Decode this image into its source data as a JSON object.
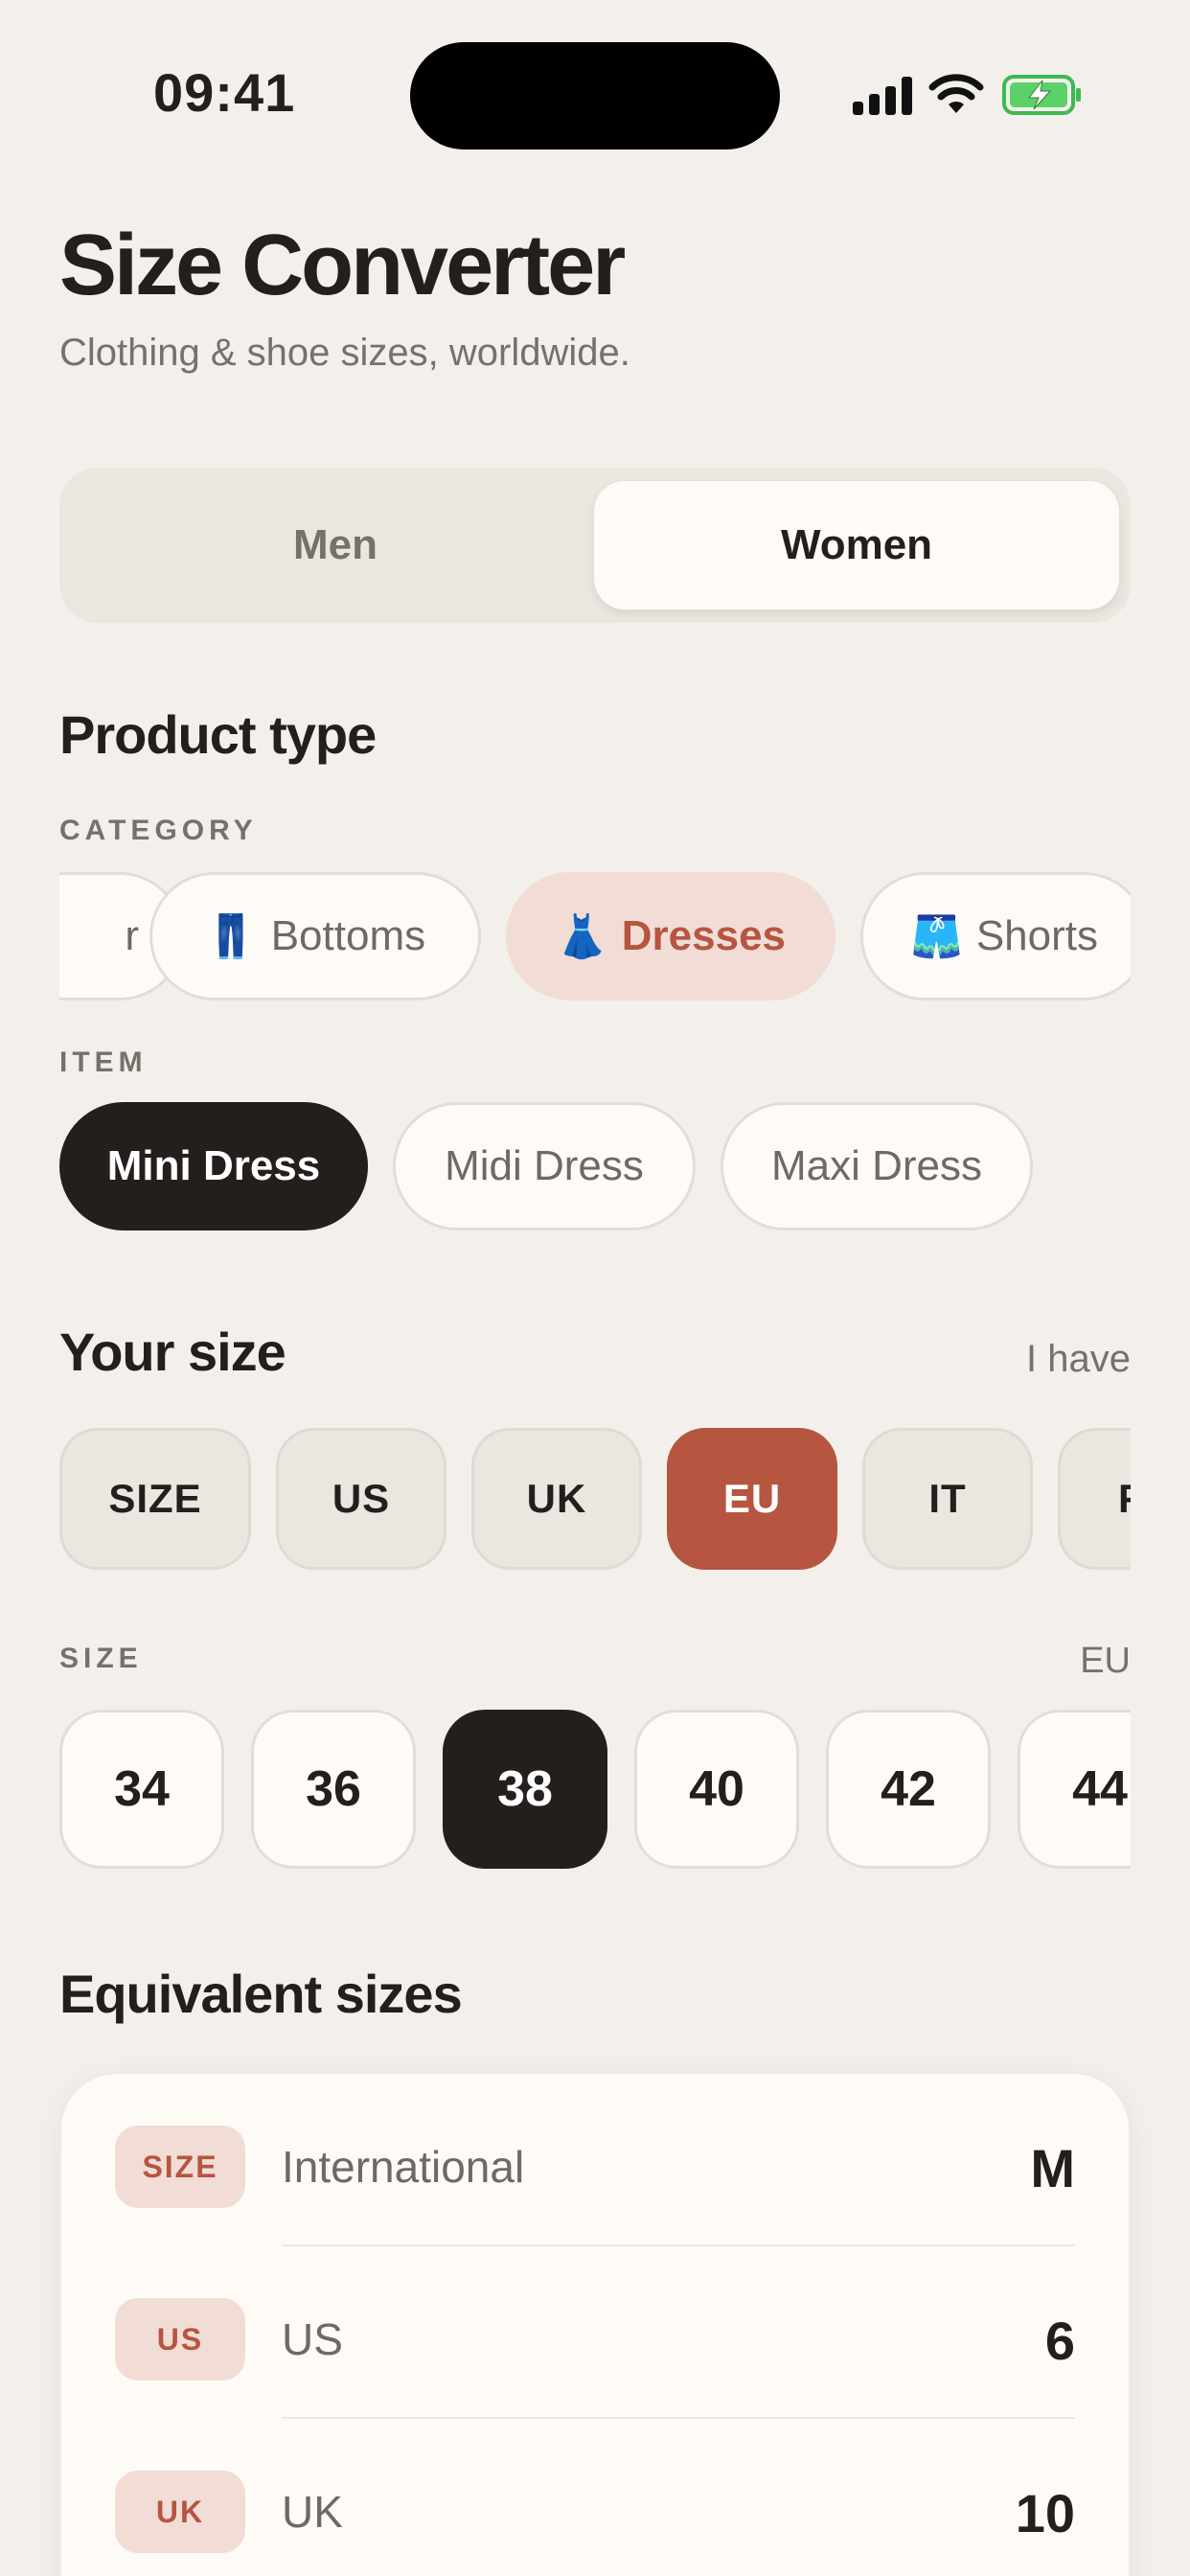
{
  "status": {
    "time": "09:41"
  },
  "header": {
    "title": "Size Converter",
    "subtitle": "Clothing & shoe sizes, worldwide."
  },
  "gender_toggle": {
    "options": [
      "Men",
      "Women"
    ],
    "selected": "Women"
  },
  "product": {
    "section_title": "Product type",
    "category_label": "CATEGORY",
    "categories": [
      {
        "icon": "",
        "label": "r"
      },
      {
        "icon": "👖",
        "label": "Bottoms"
      },
      {
        "icon": "👗",
        "label": "Dresses"
      },
      {
        "icon": "🩳",
        "label": "Shorts"
      }
    ],
    "selected_category": "Dresses",
    "item_label": "ITEM",
    "items": [
      "Mini Dress",
      "Midi Dress",
      "Maxi Dress"
    ],
    "selected_item": "Mini Dress"
  },
  "your_size": {
    "section_title": "Your size",
    "hint": "I have",
    "systems": [
      "SIZE",
      "US",
      "UK",
      "EU",
      "IT",
      "F"
    ],
    "selected_system": "EU",
    "size_label": "SIZE",
    "size_system": "EU",
    "sizes": [
      "34",
      "36",
      "38",
      "40",
      "42",
      "44"
    ],
    "selected_size": "38"
  },
  "equivalent": {
    "section_title": "Equivalent sizes",
    "rows": [
      {
        "badge": "SIZE",
        "label": "International",
        "value": "M"
      },
      {
        "badge": "US",
        "label": "US",
        "value": "6"
      },
      {
        "badge": "UK",
        "label": "UK",
        "value": "10"
      }
    ]
  },
  "colors": {
    "accent": "#B65540",
    "dark": "#241F1C",
    "background": "#F3F0EB",
    "chip_selected_bg": "#F1DDD5"
  }
}
